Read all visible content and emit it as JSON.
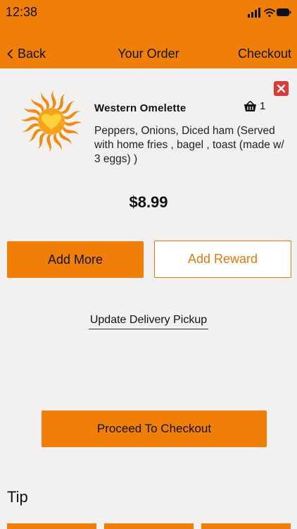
{
  "status_bar": {
    "time": "12:38"
  },
  "nav": {
    "back_label": "Back",
    "title": "Your Order",
    "checkout_label": "Checkout"
  },
  "order_item": {
    "name": "Western Omelette",
    "quantity": "1",
    "description": "Peppers, Onions, Diced ham (Served with home fries , bagel , toast (made w/ 3 eggs) )",
    "price": "$8.99"
  },
  "actions": {
    "add_more": "Add More",
    "add_reward": "Add Reward",
    "update_delivery": "Update Delivery Pickup",
    "proceed_checkout": "Proceed To Checkout"
  },
  "tip": {
    "label": "Tip"
  },
  "colors": {
    "accent": "#f07f0a",
    "remove": "#d93a3a",
    "background": "#f2f1f0"
  },
  "icons": {
    "back": "chevron-left-icon",
    "remove": "close-icon",
    "quantity": "basket-icon",
    "logo": "sun-heart-logo"
  }
}
